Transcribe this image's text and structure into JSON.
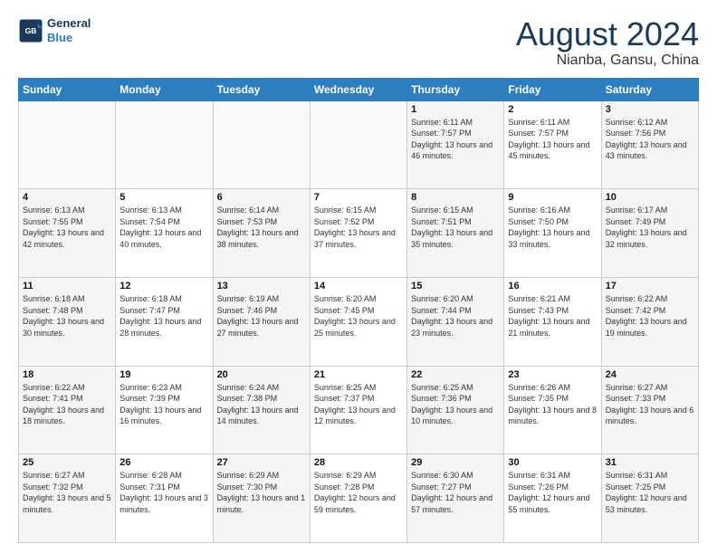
{
  "header": {
    "logo_line1": "General",
    "logo_line2": "Blue",
    "main_title": "August 2024",
    "subtitle": "Nianba, Gansu, China"
  },
  "weekdays": [
    "Sunday",
    "Monday",
    "Tuesday",
    "Wednesday",
    "Thursday",
    "Friday",
    "Saturday"
  ],
  "weeks": [
    [
      {
        "day": "",
        "sunrise": "",
        "sunset": "",
        "daylight": ""
      },
      {
        "day": "",
        "sunrise": "",
        "sunset": "",
        "daylight": ""
      },
      {
        "day": "",
        "sunrise": "",
        "sunset": "",
        "daylight": ""
      },
      {
        "day": "",
        "sunrise": "",
        "sunset": "",
        "daylight": ""
      },
      {
        "day": "1",
        "sunrise": "6:11 AM",
        "sunset": "7:57 PM",
        "daylight": "13 hours and 46 minutes."
      },
      {
        "day": "2",
        "sunrise": "6:11 AM",
        "sunset": "7:57 PM",
        "daylight": "13 hours and 45 minutes."
      },
      {
        "day": "3",
        "sunrise": "6:12 AM",
        "sunset": "7:56 PM",
        "daylight": "13 hours and 43 minutes."
      }
    ],
    [
      {
        "day": "4",
        "sunrise": "6:13 AM",
        "sunset": "7:55 PM",
        "daylight": "13 hours and 42 minutes."
      },
      {
        "day": "5",
        "sunrise": "6:13 AM",
        "sunset": "7:54 PM",
        "daylight": "13 hours and 40 minutes."
      },
      {
        "day": "6",
        "sunrise": "6:14 AM",
        "sunset": "7:53 PM",
        "daylight": "13 hours and 38 minutes."
      },
      {
        "day": "7",
        "sunrise": "6:15 AM",
        "sunset": "7:52 PM",
        "daylight": "13 hours and 37 minutes."
      },
      {
        "day": "8",
        "sunrise": "6:15 AM",
        "sunset": "7:51 PM",
        "daylight": "13 hours and 35 minutes."
      },
      {
        "day": "9",
        "sunrise": "6:16 AM",
        "sunset": "7:50 PM",
        "daylight": "13 hours and 33 minutes."
      },
      {
        "day": "10",
        "sunrise": "6:17 AM",
        "sunset": "7:49 PM",
        "daylight": "13 hours and 32 minutes."
      }
    ],
    [
      {
        "day": "11",
        "sunrise": "6:18 AM",
        "sunset": "7:48 PM",
        "daylight": "13 hours and 30 minutes."
      },
      {
        "day": "12",
        "sunrise": "6:18 AM",
        "sunset": "7:47 PM",
        "daylight": "13 hours and 28 minutes."
      },
      {
        "day": "13",
        "sunrise": "6:19 AM",
        "sunset": "7:46 PM",
        "daylight": "13 hours and 27 minutes."
      },
      {
        "day": "14",
        "sunrise": "6:20 AM",
        "sunset": "7:45 PM",
        "daylight": "13 hours and 25 minutes."
      },
      {
        "day": "15",
        "sunrise": "6:20 AM",
        "sunset": "7:44 PM",
        "daylight": "13 hours and 23 minutes."
      },
      {
        "day": "16",
        "sunrise": "6:21 AM",
        "sunset": "7:43 PM",
        "daylight": "13 hours and 21 minutes."
      },
      {
        "day": "17",
        "sunrise": "6:22 AM",
        "sunset": "7:42 PM",
        "daylight": "13 hours and 19 minutes."
      }
    ],
    [
      {
        "day": "18",
        "sunrise": "6:22 AM",
        "sunset": "7:41 PM",
        "daylight": "13 hours and 18 minutes."
      },
      {
        "day": "19",
        "sunrise": "6:23 AM",
        "sunset": "7:39 PM",
        "daylight": "13 hours and 16 minutes."
      },
      {
        "day": "20",
        "sunrise": "6:24 AM",
        "sunset": "7:38 PM",
        "daylight": "13 hours and 14 minutes."
      },
      {
        "day": "21",
        "sunrise": "6:25 AM",
        "sunset": "7:37 PM",
        "daylight": "13 hours and 12 minutes."
      },
      {
        "day": "22",
        "sunrise": "6:25 AM",
        "sunset": "7:36 PM",
        "daylight": "13 hours and 10 minutes."
      },
      {
        "day": "23",
        "sunrise": "6:26 AM",
        "sunset": "7:35 PM",
        "daylight": "13 hours and 8 minutes."
      },
      {
        "day": "24",
        "sunrise": "6:27 AM",
        "sunset": "7:33 PM",
        "daylight": "13 hours and 6 minutes."
      }
    ],
    [
      {
        "day": "25",
        "sunrise": "6:27 AM",
        "sunset": "7:32 PM",
        "daylight": "13 hours and 5 minutes."
      },
      {
        "day": "26",
        "sunrise": "6:28 AM",
        "sunset": "7:31 PM",
        "daylight": "13 hours and 3 minutes."
      },
      {
        "day": "27",
        "sunrise": "6:29 AM",
        "sunset": "7:30 PM",
        "daylight": "13 hours and 1 minute."
      },
      {
        "day": "28",
        "sunrise": "6:29 AM",
        "sunset": "7:28 PM",
        "daylight": "12 hours and 59 minutes."
      },
      {
        "day": "29",
        "sunrise": "6:30 AM",
        "sunset": "7:27 PM",
        "daylight": "12 hours and 57 minutes."
      },
      {
        "day": "30",
        "sunrise": "6:31 AM",
        "sunset": "7:26 PM",
        "daylight": "12 hours and 55 minutes."
      },
      {
        "day": "31",
        "sunrise": "6:31 AM",
        "sunset": "7:25 PM",
        "daylight": "12 hours and 53 minutes."
      }
    ]
  ]
}
